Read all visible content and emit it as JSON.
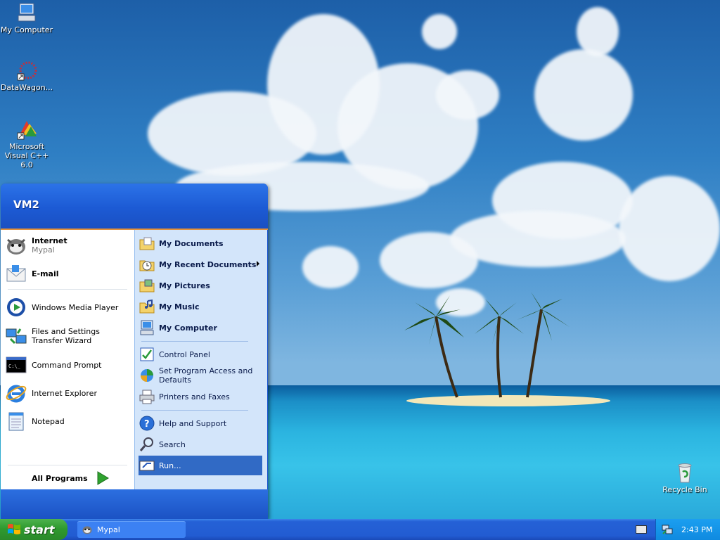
{
  "desktop": {
    "icons": [
      {
        "label": "My Computer",
        "icon": "computer-icon"
      },
      {
        "label": "DataWagon...",
        "icon": "datawagon-icon"
      },
      {
        "label": "Microsoft Visual C++ 6.0",
        "icon": "visual-cpp-icon"
      },
      {
        "label": "Recycle Bin",
        "icon": "recycle-bin-icon"
      }
    ]
  },
  "start_menu": {
    "user": "VM2",
    "left_items": [
      {
        "title": "Internet",
        "subtitle": "Mypal",
        "icon": "mypal-icon"
      },
      {
        "title": "E-mail",
        "icon": "email-icon"
      },
      {
        "title": "Windows Media Player",
        "icon": "media-player-icon"
      },
      {
        "title": "Files and Settings Transfer Wizard",
        "icon": "transfer-wizard-icon"
      },
      {
        "title": "Command Prompt",
        "icon": "command-prompt-icon"
      },
      {
        "title": "Internet Explorer",
        "icon": "internet-explorer-icon"
      },
      {
        "title": "Notepad",
        "icon": "notepad-icon"
      }
    ],
    "all_programs": "All Programs",
    "right_items": [
      {
        "title": "My Documents",
        "icon": "my-documents-icon"
      },
      {
        "title": "My Recent Documents",
        "icon": "recent-documents-icon"
      },
      {
        "title": "My Pictures",
        "icon": "my-pictures-icon"
      },
      {
        "title": "My Music",
        "icon": "my-music-icon"
      },
      {
        "title": "My Computer",
        "icon": "computer-icon"
      },
      {
        "title": "Control Panel",
        "icon": "control-panel-icon"
      },
      {
        "title": "Set Program Access and Defaults",
        "icon": "program-defaults-icon"
      },
      {
        "title": "Printers and Faxes",
        "icon": "printer-icon"
      },
      {
        "title": "Help and Support",
        "icon": "help-icon"
      },
      {
        "title": "Search",
        "icon": "search-icon"
      },
      {
        "title": "Run...",
        "icon": "run-icon"
      }
    ]
  },
  "taskbar": {
    "start_label": "start",
    "tasks": [
      {
        "label": "Mypal",
        "icon": "mypal-icon"
      }
    ],
    "clock": "2:43 PM"
  },
  "colors": {
    "accent_blue": "#1c56cf",
    "selection": "#316ac5",
    "start_green": "#2f9a2f",
    "header_stripe": "#e2913a"
  }
}
